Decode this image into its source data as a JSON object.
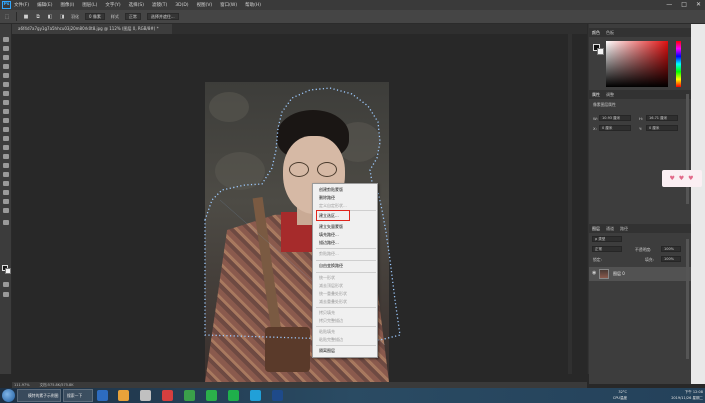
{
  "menubar": {
    "items": [
      "文件(F)",
      "编辑(E)",
      "图像(I)",
      "图层(L)",
      "文字(Y)",
      "选择(S)",
      "滤镜(T)",
      "3D(D)",
      "视图(V)",
      "窗口(W)",
      "帮助(H)"
    ],
    "window_controls": [
      "—",
      "□",
      "✕"
    ]
  },
  "options": {
    "feather_label": "羽化",
    "feather_value": "0 像素",
    "style_label": "样式",
    "style_value": "正常",
    "refine_label": "选择并遮住..."
  },
  "document": {
    "tab_title": "a6f4d7a7gy1g7a5hhcu03j20m80rk0t8.jpg @ 112% (图层 0, RGB/8#) *",
    "zoom": "111.97%",
    "doc_info": "文档:575.8K/575.8K"
  },
  "context_menu": {
    "items": [
      {
        "label": "创建剪贴蒙版",
        "disabled": false
      },
      {
        "label": "删除路径",
        "disabled": false
      },
      {
        "label": "定义自定形状...",
        "disabled": true
      },
      {
        "label": "建立选区...",
        "disabled": false
      },
      {
        "label": "建立矢量蒙版",
        "disabled": false
      },
      {
        "label": "填充路径...",
        "disabled": false
      },
      {
        "label": "描边路径...",
        "disabled": false
      },
      {
        "label": "剪贴路径...",
        "disabled": true
      },
      {
        "label": "自由变换路径",
        "disabled": false
      },
      {
        "label": "统一形状",
        "disabled": true
      },
      {
        "label": "减去顶层形状",
        "disabled": true
      },
      {
        "label": "统一重叠处形状",
        "disabled": true
      },
      {
        "label": "减去重叠处形状",
        "disabled": true
      },
      {
        "label": "拷贝填充",
        "disabled": true
      },
      {
        "label": "拷贝完整描边",
        "disabled": true
      },
      {
        "label": "粘贴填充",
        "disabled": true
      },
      {
        "label": "粘贴完整描边",
        "disabled": true
      },
      {
        "label": "隔离图层",
        "disabled": false
      }
    ],
    "highlight_color": "#e0251c"
  },
  "panels": {
    "color_tabs": [
      "颜色",
      "色板"
    ],
    "properties_tabs": [
      "属性",
      "调整"
    ],
    "properties_title": "像素图层属性",
    "w_label": "W:",
    "w_value": "10.93 厘米",
    "h_label": "H:",
    "h_value": "16.71 厘米",
    "x_label": "X:",
    "x_value": "0 厘米",
    "y_label": "Y:",
    "y_value": "0 厘米",
    "layers_tabs": [
      "图层",
      "通道",
      "路径"
    ],
    "kind_label": "ρ 类型",
    "blend_mode": "正常",
    "opacity_label": "不透明度:",
    "opacity_value": "100%",
    "lock_label": "锁定:",
    "fill_label": "填充:",
    "fill_value": "100%",
    "layer_name": "图层 0"
  },
  "taskbar": {
    "tasks": [
      "模特的素子示例图",
      "搜索一下"
    ],
    "tray_temp": "32°C",
    "tray_cpu": "CPU温度",
    "tray_time": "下午 12:08",
    "tray_date": "2019/11/26 星期二"
  },
  "colors": {
    "selection_dots": "#9ecbff",
    "ps_accent": "#31a8ff"
  }
}
